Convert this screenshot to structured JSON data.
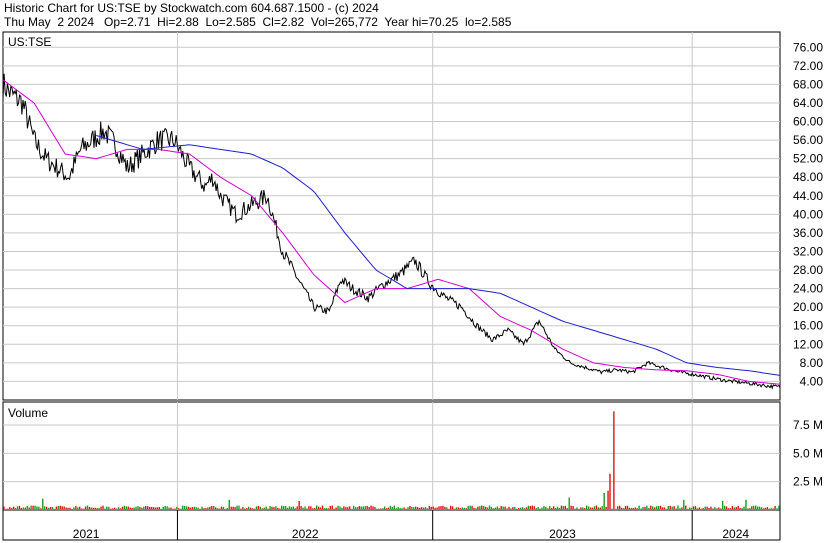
{
  "header": {
    "line1": "Historic Chart for US:TSE by Stockwatch.com 604.687.1500 - (c) 2024",
    "line2": "Thu May  2 2024   Op=2.71  Hi=2.88  Lo=2.585  Cl=2.82  Vol=265,772  Year hi=70.25  lo=2.585"
  },
  "colors": {
    "price": "#000000",
    "ma_short": "#d400d4",
    "ma_long": "#1f1fd0",
    "volume_up": "#1a9c1a",
    "volume_down": "#e01010",
    "grid": "#c8c8c8"
  },
  "chart_data": [
    {
      "type": "line",
      "title": "US:TSE",
      "x_labels": [
        "2021",
        "2022",
        "2023",
        "2024"
      ],
      "y_ticks": [
        "76.00",
        "72.00",
        "68.00",
        "64.00",
        "60.00",
        "56.00",
        "52.00",
        "48.00",
        "44.00",
        "40.00",
        "36.00",
        "32.00",
        "28.00",
        "24.00",
        "20.00",
        "16.00",
        "12.00",
        "8.00",
        "4.00"
      ],
      "ylim": [
        0,
        78
      ],
      "grid": true,
      "series": [
        {
          "role": "price",
          "t": [
            0,
            0.01,
            0.025,
            0.04,
            0.055,
            0.07,
            0.085,
            0.1,
            0.115,
            0.13,
            0.145,
            0.16,
            0.18,
            0.2,
            0.22,
            0.24,
            0.26,
            0.27,
            0.28,
            0.3,
            0.32,
            0.34,
            0.36,
            0.38,
            0.4,
            0.42,
            0.435,
            0.45,
            0.47,
            0.49,
            0.51,
            0.53,
            0.55,
            0.57,
            0.59,
            0.61,
            0.63,
            0.65,
            0.67,
            0.69,
            0.71,
            0.73,
            0.75,
            0.77,
            0.79,
            0.81,
            0.83,
            0.85,
            0.87,
            0.89,
            0.91,
            0.93,
            0.95,
            0.97,
            0.985,
            1.0
          ],
          "values": [
            68,
            66,
            64,
            56,
            52,
            50,
            48,
            54,
            56,
            58,
            55,
            50,
            53,
            56,
            56,
            50,
            46,
            48,
            44,
            40,
            42,
            44,
            32,
            26,
            20,
            19,
            26,
            24,
            22,
            25,
            27,
            30,
            25,
            22,
            20,
            16,
            13,
            15,
            12,
            17,
            11,
            8,
            7,
            6,
            6.5,
            6,
            8,
            7,
            6,
            5.5,
            4.8,
            4.2,
            3.8,
            3.4,
            3.0,
            2.82
          ]
        },
        {
          "role": "ma_short",
          "t": [
            0,
            0.04,
            0.08,
            0.12,
            0.16,
            0.2,
            0.24,
            0.28,
            0.32,
            0.36,
            0.4,
            0.44,
            0.48,
            0.52,
            0.56,
            0.6,
            0.64,
            0.68,
            0.72,
            0.76,
            0.8,
            0.84,
            0.88,
            0.92,
            0.96,
            1.0
          ],
          "values": [
            69,
            64,
            53,
            52,
            54,
            54,
            53,
            48,
            44,
            36,
            27,
            21,
            24,
            24,
            26,
            24,
            18,
            15,
            11,
            8,
            7,
            6.5,
            6.3,
            5.5,
            4,
            3.4
          ]
        },
        {
          "role": "ma_long",
          "t": [
            0.12,
            0.18,
            0.24,
            0.28,
            0.32,
            0.36,
            0.4,
            0.44,
            0.48,
            0.52,
            0.56,
            0.6,
            0.64,
            0.68,
            0.72,
            0.76,
            0.8,
            0.84,
            0.88,
            0.92,
            0.96,
            1.0
          ],
          "values": [
            57,
            54,
            55,
            54,
            53,
            50,
            45,
            36,
            28,
            24,
            24,
            24,
            23,
            20,
            17,
            15,
            13,
            11,
            8,
            7,
            6.3,
            5.3
          ]
        }
      ]
    },
    {
      "type": "bar",
      "title": "Volume",
      "y_ticks": [
        "7.5 M",
        "5.0 M",
        "2.5 M"
      ],
      "ylim": [
        0,
        9
      ],
      "notable": [
        {
          "t": 0.786,
          "value": 8.7,
          "dir": "down"
        },
        {
          "t": 0.78,
          "value": 3.2,
          "dir": "down"
        },
        {
          "t": 0.777,
          "value": 1.7,
          "dir": "down"
        },
        {
          "t": 0.773,
          "value": 1.5,
          "dir": "up"
        },
        {
          "t": 0.727,
          "value": 1.1,
          "dir": "up"
        },
        {
          "t": 0.05,
          "value": 1.0,
          "dir": "up"
        },
        {
          "t": 0.29,
          "value": 0.9,
          "dir": "up"
        },
        {
          "t": 0.38,
          "value": 0.8,
          "dir": "down"
        },
        {
          "t": 0.875,
          "value": 0.9,
          "dir": "up"
        },
        {
          "t": 0.925,
          "value": 0.8,
          "dir": "up"
        },
        {
          "t": 0.955,
          "value": 0.9,
          "dir": "up"
        }
      ],
      "baseline": 0.25
    }
  ]
}
